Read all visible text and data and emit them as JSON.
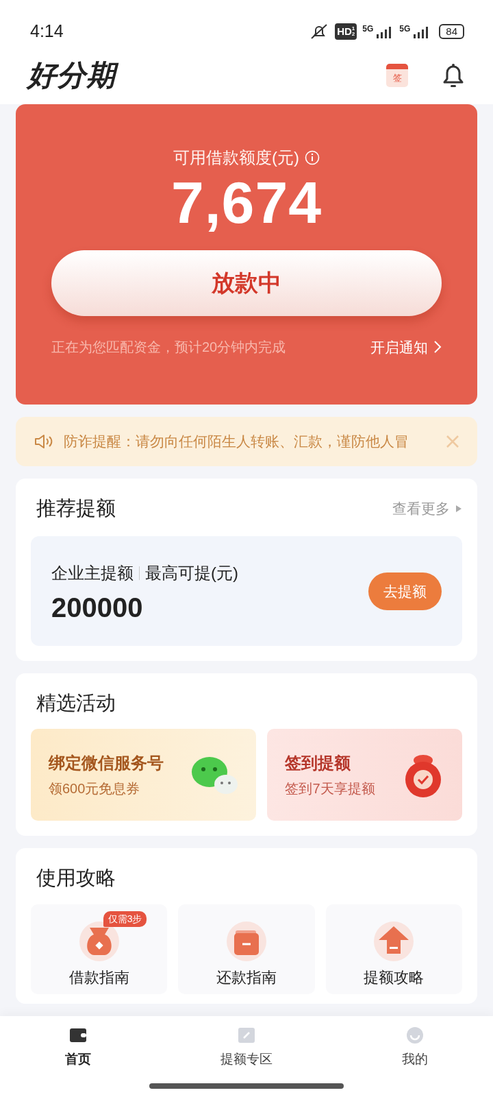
{
  "status_bar": {
    "time": "4:14",
    "hd": "HD",
    "hd_sims": [
      "1",
      "2"
    ],
    "networks": [
      "5G",
      "5G"
    ],
    "battery": "84"
  },
  "header": {
    "logo": "好分期",
    "checkin_icon_text": "签"
  },
  "credit": {
    "label": "可用借款额度(元)",
    "amount": "7,674",
    "button": "放款中",
    "note": "正在为您匹配资金，预计20分钟内完成",
    "link": "开启通知"
  },
  "notice": {
    "text": "防诈提醒：请勿向任何陌生人转账、汇款，谨防他人冒"
  },
  "recommend": {
    "title": "推荐提额",
    "more": "查看更多",
    "item": {
      "name": "企业主提额",
      "sub": "最高可提(元)",
      "amount": "200000",
      "button": "去提额"
    }
  },
  "activities": {
    "title": "精选活动",
    "items": [
      {
        "kind": "wechat",
        "title": "绑定微信服务号",
        "sub": "领600元免息券"
      },
      {
        "kind": "bag",
        "title": "签到提额",
        "sub": "签到7天享提额"
      }
    ]
  },
  "guides": {
    "title": "使用攻略",
    "items": [
      {
        "kind": "bag",
        "label": "借款指南",
        "badge": "仅需3步"
      },
      {
        "kind": "wallet",
        "label": "还款指南"
      },
      {
        "kind": "up",
        "label": "提额攻略"
      }
    ]
  },
  "tabs": [
    {
      "kind": "home",
      "label": "首页",
      "selected": true
    },
    {
      "kind": "raise",
      "label": "提额专区",
      "selected": false
    },
    {
      "kind": "me",
      "label": "我的",
      "selected": false
    }
  ]
}
